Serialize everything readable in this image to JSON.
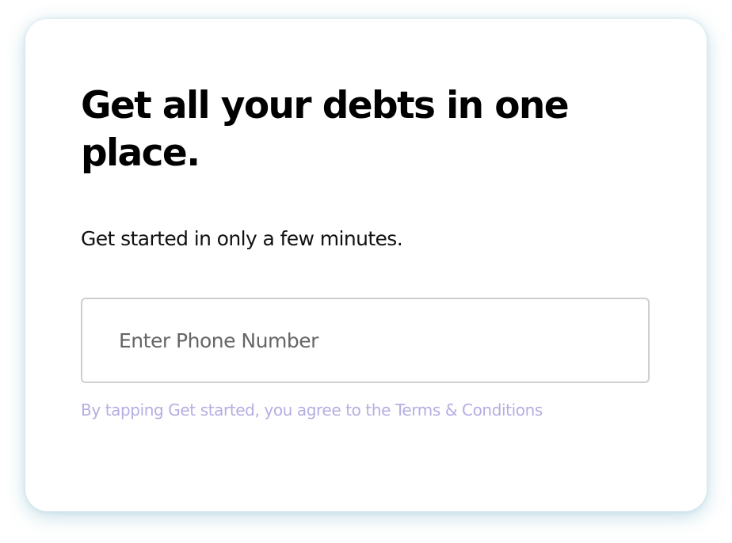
{
  "card": {
    "headline": "Get all your debts in one place.",
    "subhead": "Get started in only a few minutes."
  },
  "phone_input": {
    "value": "",
    "placeholder": "Enter Phone Number"
  },
  "terms": {
    "prefix": "By tapping Get started, you agree to the ",
    "link_label": "Terms & Conditions"
  },
  "colors": {
    "headline": "#000000",
    "terms_text": "#b4aee3",
    "input_border": "#cfcfcf",
    "card_shadow": "#78b4c8"
  }
}
